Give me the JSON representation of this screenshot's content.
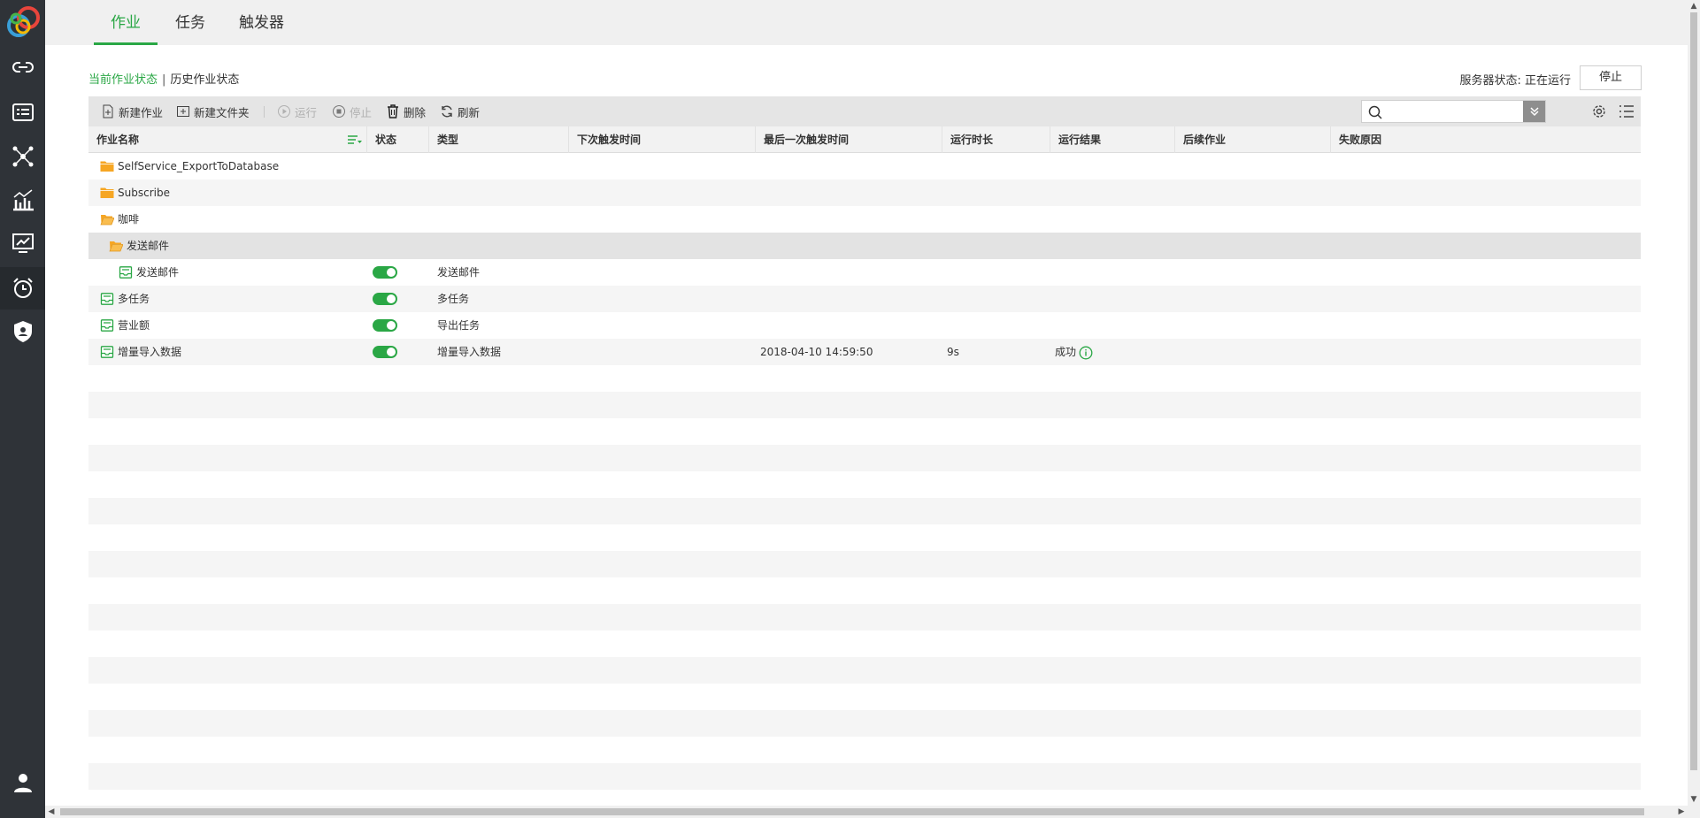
{
  "app": {
    "tabs": [
      {
        "label": "作业",
        "active": true
      },
      {
        "label": "任务",
        "active": false
      },
      {
        "label": "触发器",
        "active": false
      }
    ]
  },
  "sidebar": {
    "items": [
      {
        "name": "link-icon"
      },
      {
        "name": "list-card-icon"
      },
      {
        "name": "network-icon"
      },
      {
        "name": "chart-icon"
      },
      {
        "name": "presentation-icon"
      },
      {
        "name": "alarm-clock-icon",
        "active": true
      },
      {
        "name": "shield-user-icon"
      },
      {
        "name": "user-icon"
      }
    ]
  },
  "subnav": {
    "current": "当前作业状态",
    "separator": "|",
    "history": "历史作业状态"
  },
  "server": {
    "status_label": "服务器状态:",
    "status_value": "正在运行",
    "stop_label": "停止"
  },
  "toolbar": {
    "new_job": "新建作业",
    "new_folder": "新建文件夹",
    "run": "运行",
    "stop": "停止",
    "delete": "删除",
    "refresh": "刷新",
    "search_placeholder": ""
  },
  "grid": {
    "columns": [
      "作业名称",
      "状态",
      "类型",
      "下次触发时间",
      "最后一次触发时间",
      "运行时长",
      "运行结果",
      "后续作业",
      "失败原因"
    ],
    "rows": [
      {
        "kind": "folder",
        "name": "SelfService_ExportToDatabase",
        "indent": 0
      },
      {
        "kind": "folder",
        "name": "Subscribe",
        "indent": 0
      },
      {
        "kind": "folder-open",
        "name": "咖啡",
        "indent": 0
      },
      {
        "kind": "folder-open",
        "name": "发送邮件",
        "indent": 1,
        "selected": true
      },
      {
        "kind": "job",
        "name": "发送邮件",
        "indent": 2,
        "enabled": true,
        "type": "发送邮件",
        "last_trigger": "",
        "duration": "",
        "result": ""
      },
      {
        "kind": "job",
        "name": "多任务",
        "indent": 0,
        "enabled": true,
        "type": "多任务",
        "last_trigger": "",
        "duration": "",
        "result": ""
      },
      {
        "kind": "job",
        "name": "营业额",
        "indent": 0,
        "enabled": true,
        "type": "导出任务",
        "last_trigger": "",
        "duration": "",
        "result": ""
      },
      {
        "kind": "job",
        "name": "增量导入数据",
        "indent": 0,
        "enabled": true,
        "type": "增量导入数据",
        "last_trigger": "2018-04-10 14:59:50",
        "duration": "9s",
        "result": "成功"
      }
    ]
  },
  "colors": {
    "accent": "#2aa745",
    "sidebar": "#2f3338",
    "folder": "#f6a623"
  }
}
